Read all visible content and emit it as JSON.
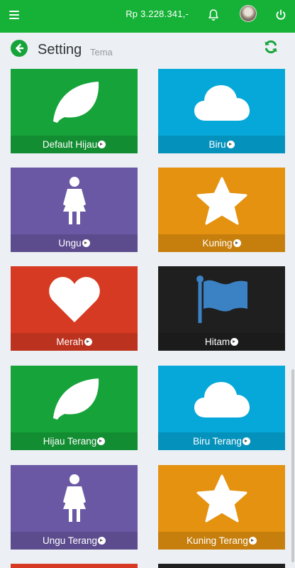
{
  "topbar": {
    "balance": "Rp 3.228.341,-",
    "menu_icon": "hamburger-icon",
    "notification_icon": "bell-icon",
    "logout_icon": "power-icon",
    "color": "#16b237"
  },
  "header": {
    "title": "Setting",
    "subtitle": "Tema",
    "back_icon": "arrow-left-circle-icon",
    "refresh_icon": "refresh-icon"
  },
  "themes": [
    {
      "label": "Default Hijau",
      "icon": "leaf-icon",
      "color": "#16a33a"
    },
    {
      "label": "Biru",
      "icon": "cloud-icon",
      "color": "#05a8d8"
    },
    {
      "label": "Ungu",
      "icon": "female-icon",
      "color": "#6a58a4"
    },
    {
      "label": "Kuning",
      "icon": "star-icon",
      "color": "#e4920f"
    },
    {
      "label": "Merah",
      "icon": "heart-icon",
      "color": "#d73a23"
    },
    {
      "label": "Hitam",
      "icon": "flag-icon",
      "color": "#1f1f1f"
    },
    {
      "label": "Hijau Terang",
      "icon": "leaf-icon",
      "color": "#16a33a"
    },
    {
      "label": "Biru Terang",
      "icon": "cloud-icon",
      "color": "#05a8d8"
    },
    {
      "label": "Ungu Terang",
      "icon": "female-icon",
      "color": "#6a58a4"
    },
    {
      "label": "Kuning Terang",
      "icon": "star-icon",
      "color": "#e4920f"
    }
  ]
}
